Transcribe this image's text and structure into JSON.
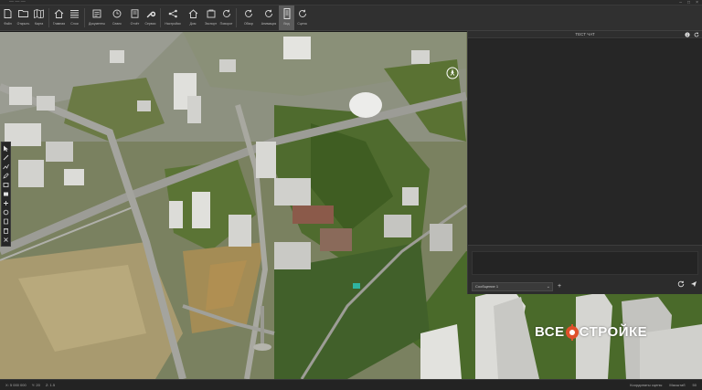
{
  "window": {
    "title": "— — —",
    "controls": [
      "–",
      "□",
      "×"
    ]
  },
  "ribbon": {
    "buttons": [
      {
        "label": "Файл",
        "icon": "file-icon"
      },
      {
        "label": "Открыть",
        "icon": "folder-icon"
      },
      {
        "label": "Карта",
        "icon": "map-icon"
      },
      {
        "label": "Главная",
        "icon": "home-icon"
      },
      {
        "label": "Слои",
        "icon": "layers-icon"
      },
      {
        "label": "Документы",
        "icon": "document-icon"
      },
      {
        "label": "Сеанс",
        "icon": "clock-icon"
      },
      {
        "label": "Отчёт",
        "icon": "report-icon"
      },
      {
        "label": "Сервис",
        "icon": "wrench-icon"
      },
      {
        "label": "Настройки",
        "icon": "network-icon"
      },
      {
        "label": "Дом",
        "icon": "house-icon"
      },
      {
        "label": "Экспорт",
        "icon": "export-icon"
      },
      {
        "label": "Поворот",
        "icon": "rotate-icon"
      },
      {
        "label": "Обзор",
        "icon": "orbit-icon"
      },
      {
        "label": "Анимация",
        "icon": "animation-icon"
      },
      {
        "label": "Вид",
        "icon": "view-icon"
      },
      {
        "label": "Сцена",
        "icon": "scene-icon"
      }
    ]
  },
  "left_tools": [
    "cursor-icon",
    "line-icon",
    "polyline-icon",
    "pen-icon",
    "rectangle-icon",
    "fill-icon",
    "plus-icon",
    "circle-icon",
    "layer-icon",
    "delete-icon",
    "close-icon"
  ],
  "panel": {
    "title": "ТЕСТ ЧАТ",
    "select_value": "Сообщение 1",
    "icons": [
      "info-icon",
      "refresh-icon"
    ]
  },
  "status": {
    "left": [
      "X: 5 000 000",
      "Y: 20",
      "Z: 1.5"
    ],
    "right": [
      "Координаты сцены",
      "Масштаб",
      "50"
    ]
  },
  "watermark": {
    "part1": "ВСЕ",
    "part2": "СТРОЙКЕ"
  }
}
